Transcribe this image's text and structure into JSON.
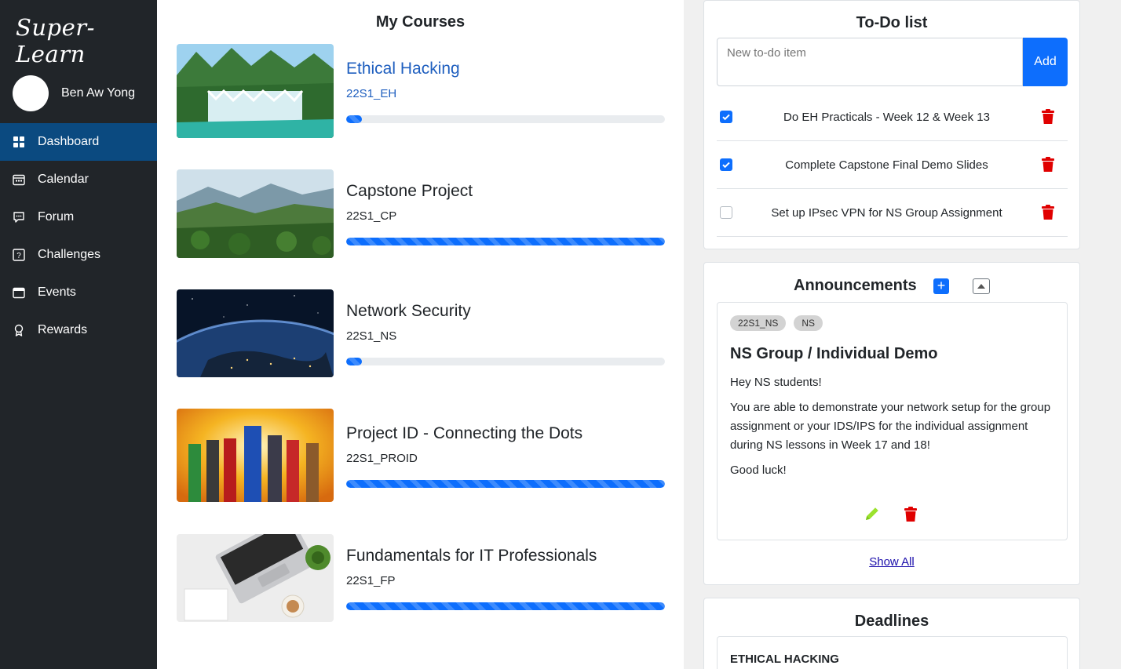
{
  "app": {
    "brand": "Super-Learn"
  },
  "user": {
    "name": "Ben Aw Yong"
  },
  "nav": [
    {
      "label": "Dashboard",
      "icon": "dashboard-icon",
      "active": true
    },
    {
      "label": "Calendar",
      "icon": "calendar-icon",
      "active": false
    },
    {
      "label": "Forum",
      "icon": "forum-icon",
      "active": false
    },
    {
      "label": "Challenges",
      "icon": "challenges-icon",
      "active": false
    },
    {
      "label": "Events",
      "icon": "events-icon",
      "active": false
    },
    {
      "label": "Rewards",
      "icon": "rewards-icon",
      "active": false
    }
  ],
  "courses": {
    "title": "My Courses",
    "items": [
      {
        "name": "Ethical Hacking",
        "code": "22S1_EH",
        "progress": 0.05,
        "image": "waterfall"
      },
      {
        "name": "Capstone Project",
        "code": "22S1_CP",
        "progress": 1.0,
        "image": "mountain-forest"
      },
      {
        "name": "Network Security",
        "code": "22S1_NS",
        "progress": 0.05,
        "image": "earth-from-space"
      },
      {
        "name": "Project ID - Connecting the Dots",
        "code": "22S1_PROID",
        "progress": 1.0,
        "image": "superheroes"
      },
      {
        "name": "Fundamentals for IT Professionals",
        "code": "22S1_FP",
        "progress": 1.0,
        "image": "laptop-desk"
      }
    ]
  },
  "todo": {
    "title": "To-Do list",
    "placeholder": "New to-do item",
    "add_label": "Add",
    "items": [
      {
        "text": "Do EH Practicals - Week 12 & Week 13",
        "checked": true
      },
      {
        "text": "Complete Capstone Final Demo Slides",
        "checked": true
      },
      {
        "text": "Set up IPsec VPN for NS Group Assignment",
        "checked": false
      }
    ]
  },
  "announcements": {
    "title": "Announcements",
    "add_symbol": "+",
    "tags": [
      "22S1_NS",
      "NS"
    ],
    "heading": "NS Group / Individual Demo",
    "body": [
      "Hey NS students!",
      "You are able to demonstrate your network setup for the group assignment or your IDS/IPS for the individual assignment during NS lessons in Week 17 and 18!",
      "Good luck!"
    ],
    "show_all": "Show All",
    "colors": {
      "edit": "#9be22d",
      "delete": "#e00000",
      "accent": "#0d6efd"
    }
  },
  "deadlines": {
    "title": "Deadlines",
    "course": "ETHICAL HACKING"
  }
}
